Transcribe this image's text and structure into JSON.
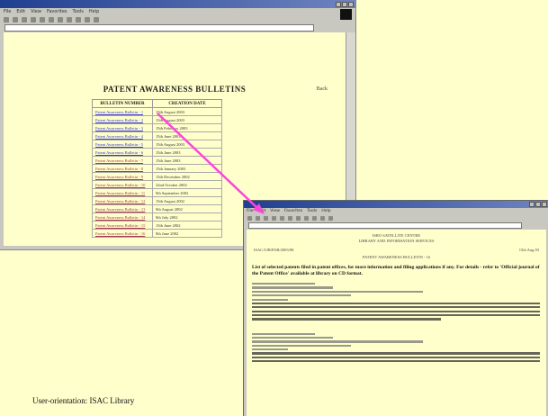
{
  "slide": {
    "background": "#ffffcc",
    "caption": "User-orientation: ISAC Library"
  },
  "back_window": {
    "menu": [
      "File",
      "Edit",
      "View",
      "Favorites",
      "Tools",
      "Help"
    ],
    "page": {
      "top_right_label": "Back",
      "title": "PATENT AWARENESS BULLETINS",
      "columns": [
        "BULLETIN NUMBER",
        "CREATION DATE"
      ],
      "rows": [
        {
          "number": "Patent Awareness Bulletin - 1",
          "date": "15th August 2003"
        },
        {
          "number": "Patent Awareness Bulletin - 2",
          "date": "15th August 2003"
        },
        {
          "number": "Patent Awareness Bulletin - 3",
          "date": "15th February 2003"
        },
        {
          "number": "Patent Awareness Bulletin - 4",
          "date": "15th June 2003"
        },
        {
          "number": "Patent Awareness Bulletin - 5",
          "date": "15th August 2003"
        },
        {
          "number": "Patent Awareness Bulletin - 6",
          "date": "15th June 2003"
        },
        {
          "number": "Patent Awareness Bulletin - 7",
          "date": "15th June 2003"
        },
        {
          "number": "Patent Awareness Bulletin - 8",
          "date": "15th January 2003"
        },
        {
          "number": "Patent Awareness Bulletin - 9",
          "date": "15th December 2002"
        },
        {
          "number": "Patent Awareness Bulletin - 10",
          "date": "22nd October 2002"
        },
        {
          "number": "Patent Awareness Bulletin - 11",
          "date": "9th September 2002"
        },
        {
          "number": "Patent Awareness Bulletin - 12",
          "date": "15th August 2002"
        },
        {
          "number": "Patent Awareness Bulletin - 13",
          "date": "9th August 2002"
        },
        {
          "number": "Patent Awareness Bulletin - 14",
          "date": "9th July 2002"
        },
        {
          "number": "Patent Awareness Bulletin - 15",
          "date": "15th June 2002"
        },
        {
          "number": "Patent Awareness Bulletin - 16",
          "date": "9th June 2002"
        }
      ]
    }
  },
  "front_window": {
    "menu": [
      "File",
      "Edit",
      "View",
      "Favorites",
      "Tools",
      "Help"
    ],
    "page": {
      "header_line1": "ISRO SATELLITE CENTRE",
      "header_line2": "LIBRARY AND INFORMATION SERVICES",
      "ref_left": "ISAC/LIB/PAB/2003/08",
      "ref_right": "15th Aug 03",
      "bulletin_label": "PATENT AWARENESS BULLETIN - 16",
      "notice": "List of selected patents filed in patent offices, for more information and filing applications if any. For details - refer to 'Official journal of the Patent Office' available at library on CD format."
    }
  }
}
